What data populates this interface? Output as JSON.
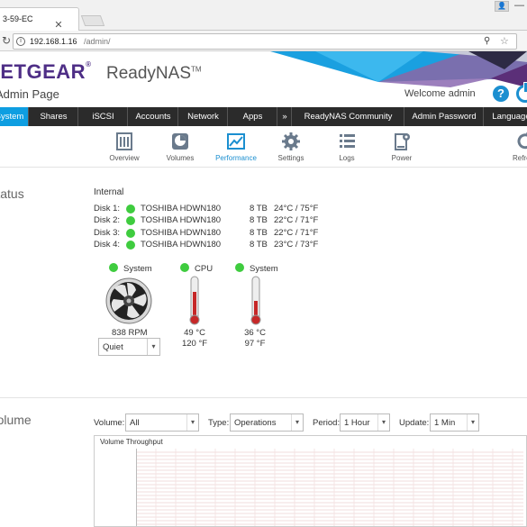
{
  "browser": {
    "tab_title": "3-59-EC",
    "url_host": "192.168.1.16",
    "url_path": "/admin/"
  },
  "header": {
    "brand": "NETGEAR",
    "product": "ReadyNAS",
    "trademark": "TM",
    "page_title": "Admin Page",
    "welcome": "Welcome admin",
    "help_label": "?",
    "brand_colors": [
      "#4e2e86",
      "#1b8fd0",
      "#0e9ee1"
    ]
  },
  "main_nav": {
    "items": [
      {
        "label": "System",
        "active": true
      },
      {
        "label": "Shares"
      },
      {
        "label": "iSCSI"
      },
      {
        "label": "Accounts"
      },
      {
        "label": "Network"
      },
      {
        "label": "Apps"
      },
      {
        "label": "»"
      },
      {
        "label": "ReadyNAS Community"
      },
      {
        "label": "Admin Password"
      },
      {
        "label": "Language"
      }
    ]
  },
  "sub_nav": {
    "items": [
      {
        "label": "Overview",
        "icon": "overview-icon"
      },
      {
        "label": "Volumes",
        "icon": "volumes-icon"
      },
      {
        "label": "Performance",
        "icon": "performance-icon",
        "active": true
      },
      {
        "label": "Settings",
        "icon": "gear-icon"
      },
      {
        "label": "Logs",
        "icon": "logs-icon"
      },
      {
        "label": "Power",
        "icon": "power-settings-icon"
      },
      {
        "label": "Refresh",
        "icon": "refresh-icon"
      }
    ]
  },
  "status": {
    "title": "Status",
    "internal_label": "Internal",
    "disks": [
      {
        "label": "Disk 1:",
        "model": "TOSHIBA HDWN180",
        "size": "8 TB",
        "temp": "24°C / 75°F"
      },
      {
        "label": "Disk 2:",
        "model": "TOSHIBA HDWN180",
        "size": "8 TB",
        "temp": "22°C / 71°F"
      },
      {
        "label": "Disk 3:",
        "model": "TOSHIBA HDWN180",
        "size": "8 TB",
        "temp": "22°C / 71°F"
      },
      {
        "label": "Disk 4:",
        "model": "TOSHIBA HDWN180",
        "size": "8 TB",
        "temp": "23°C / 73°F"
      }
    ],
    "fan": {
      "label": "System",
      "rpm": "838 RPM",
      "mode": "Quiet"
    },
    "cpu": {
      "label": "CPU",
      "celsius": "49 °C",
      "fahrenheit": "120 °F"
    },
    "system_temp": {
      "label": "System",
      "celsius": "36 °C",
      "fahrenheit": "97 °F"
    },
    "status_color": "#3fcc3f"
  },
  "volume": {
    "title": "Volume",
    "filters": {
      "volume_label": "Volume:",
      "volume_value": "All",
      "type_label": "Type:",
      "type_value": "Operations",
      "period_label": "Period:",
      "period_value": "1 Hour",
      "update_label": "Update:",
      "update_value": "1 Min"
    },
    "chart_title": "Volume Throughput"
  }
}
